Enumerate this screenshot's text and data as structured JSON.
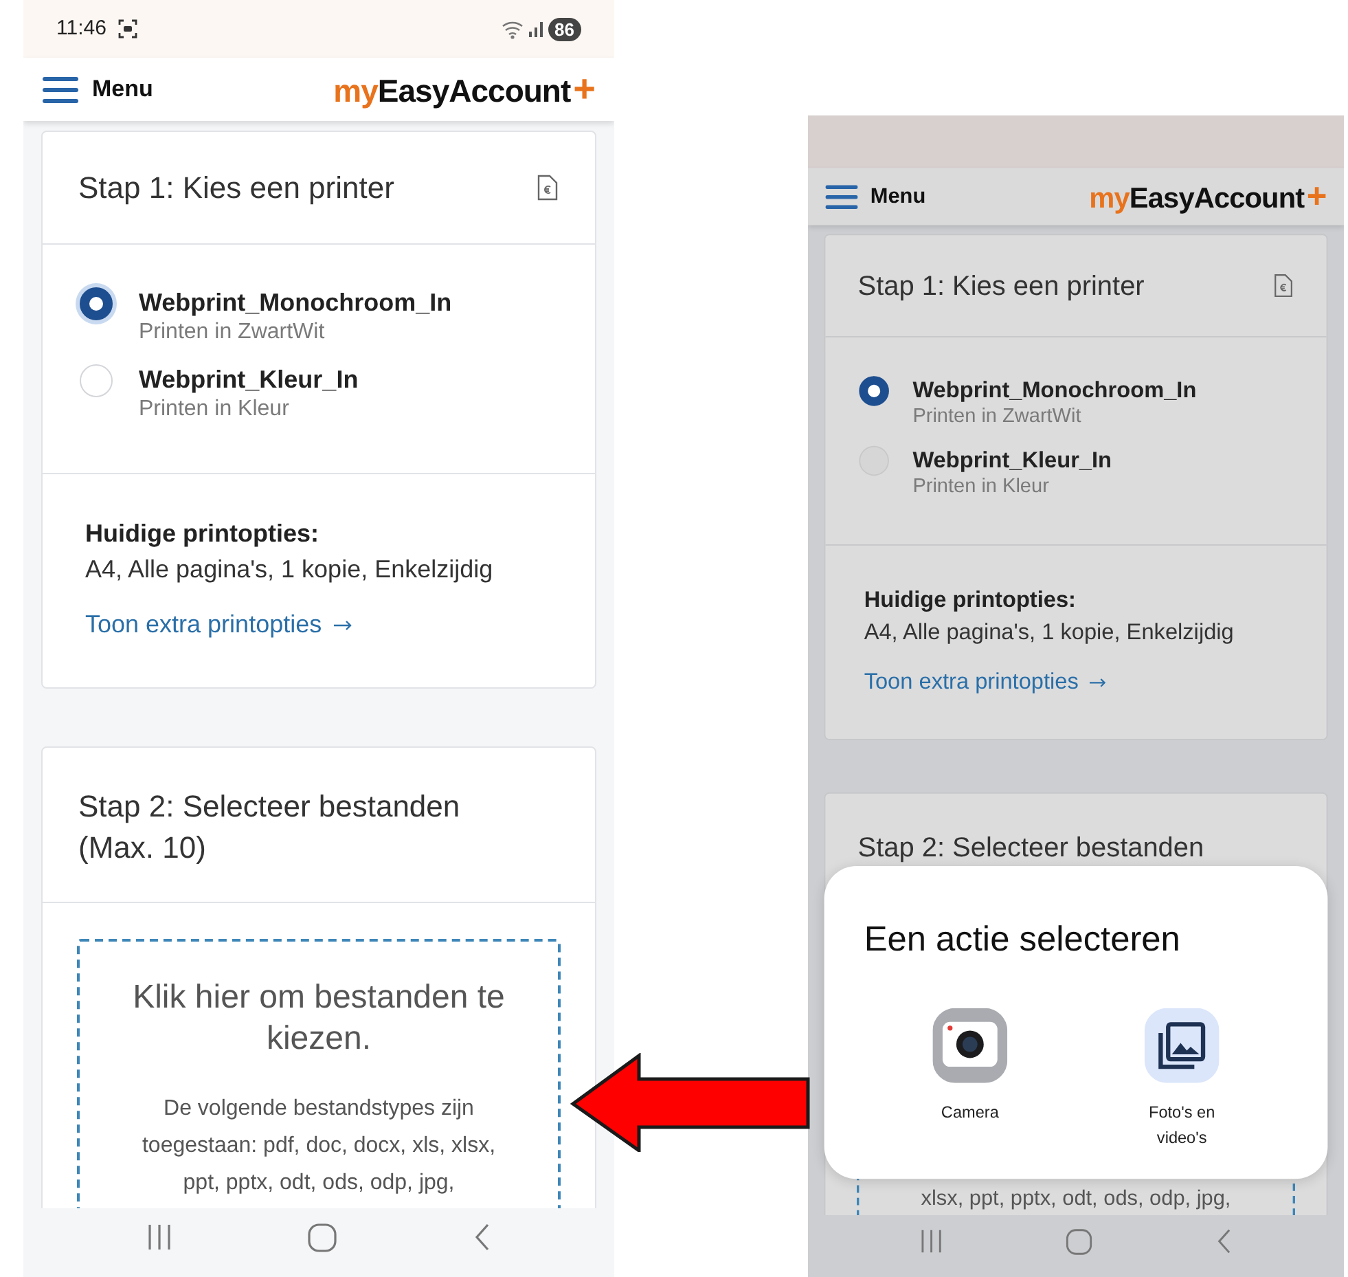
{
  "screens": [
    {
      "dimmed": false,
      "status_bar": {
        "time": "11:46",
        "battery": "86"
      },
      "header": {
        "menu_label": "Menu",
        "logo": {
          "prefix": "my",
          "name": "EasyAccount",
          "suffix": "+"
        }
      },
      "step1": {
        "title": "Stap 1: Kies een printer",
        "printers": [
          {
            "name": "Webprint_Monochroom_In",
            "description": "Printen in ZwartWit",
            "selected": true
          },
          {
            "name": "Webprint_Kleur_In",
            "description": "Printen in Kleur",
            "selected": false
          }
        ],
        "options_label": "Huidige printopties:",
        "options_value": "A4, Alle pagina's, 1 kopie, Enkelzijdig",
        "link": "Toon extra printopties"
      },
      "step2": {
        "title": "Stap 2: Selecteer bestanden (Max. 10)",
        "dropzone": {
          "title": "Klik hier om bestanden te kiezen.",
          "text": "De volgende bestandstypes zijn toegestaan: pdf, doc, docx, xls, xlsx, ppt, pptx, odt, ods, odp, jpg,"
        }
      }
    },
    {
      "dimmed": true,
      "header": {
        "menu_label": "Menu",
        "logo": {
          "prefix": "my",
          "name": "EasyAccount",
          "suffix": "+"
        }
      },
      "step1": {
        "title": "Stap 1: Kies een printer",
        "printers": [
          {
            "name": "Webprint_Monochroom_In",
            "description": "Printen in ZwartWit",
            "selected": true
          },
          {
            "name": "Webprint_Kleur_In",
            "description": "Printen in Kleur",
            "selected": false
          }
        ],
        "options_label": "Huidige printopties:",
        "options_value": "A4, Alle pagina's, 1 kopie, Enkelzijdig",
        "link": "Toon extra printopties"
      },
      "step2": {
        "title": "Stap 2: Selecteer bestanden",
        "dropzone": {
          "tail": "xlsx, ppt, pptx, odt, ods, odp, jpg,"
        }
      },
      "sheet": {
        "title": "Een actie selecteren",
        "actions": [
          {
            "label": "Camera",
            "kind": "camera"
          },
          {
            "label": "Foto's en video's",
            "kind": "gallery"
          }
        ]
      }
    }
  ]
}
